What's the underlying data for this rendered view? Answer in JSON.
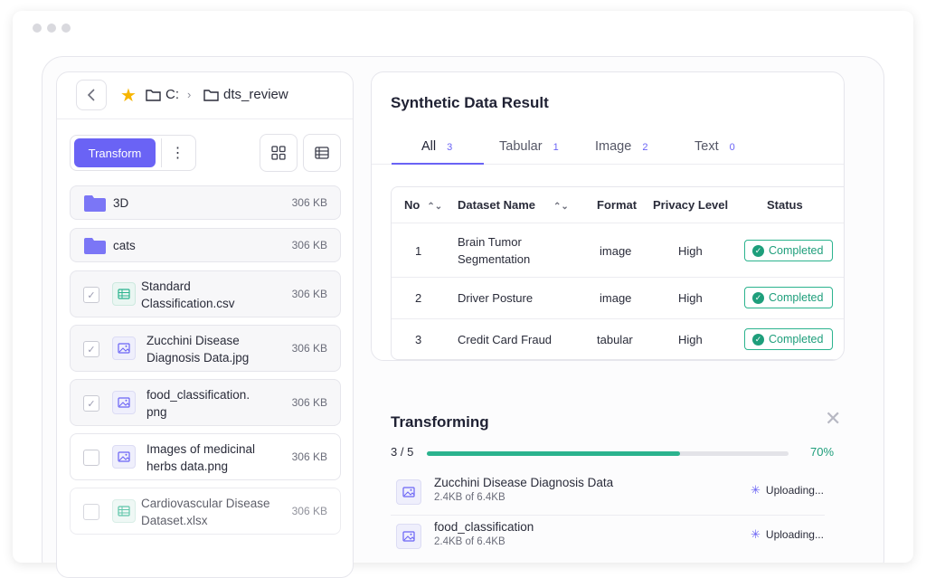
{
  "breadcrumb": {
    "drive": "C:",
    "folder": "dts_review"
  },
  "toolbar": {
    "transform_label": "Transform",
    "more_label": "⋮"
  },
  "files": [
    {
      "name": "3D",
      "size": "306 KB",
      "type": "folder"
    },
    {
      "name": "cats",
      "size": "306 KB",
      "type": "folder"
    },
    {
      "name": "Standard Classification.csv",
      "size": "306 KB",
      "type": "sheet",
      "checked": true
    },
    {
      "name": "Zucchini Disease Diagnosis Data.jpg",
      "size": "306 KB",
      "type": "image",
      "checked": true
    },
    {
      "name": "food_classification. png",
      "size": "306 KB",
      "type": "image",
      "checked": true
    },
    {
      "name": "Images of medicinal herbs data.png",
      "size": "306 KB",
      "type": "image",
      "checked": false
    },
    {
      "name": "Cardiovascular Disease Dataset.xlsx",
      "size": "306 KB",
      "type": "sheet",
      "checked": false
    }
  ],
  "result": {
    "title": "Synthetic Data Result",
    "tabs": [
      {
        "label": "All",
        "count": "3"
      },
      {
        "label": "Tabular",
        "count": "1"
      },
      {
        "label": "Image",
        "count": "2"
      },
      {
        "label": "Text",
        "count": "0"
      }
    ],
    "columns": {
      "no": "No",
      "name": "Dataset Name",
      "format": "Format",
      "privacy": "Privacy Level",
      "status": "Status"
    },
    "rows": [
      {
        "no": "1",
        "name": "Brain Tumor Segmentation",
        "format": "image",
        "privacy": "High",
        "status": "Completed"
      },
      {
        "no": "2",
        "name": "Driver Posture",
        "format": "image",
        "privacy": "High",
        "status": "Completed"
      },
      {
        "no": "3",
        "name": "Credit Card Fraud",
        "format": "tabular",
        "privacy": "High",
        "status": "Completed"
      }
    ]
  },
  "transforming": {
    "title": "Transforming",
    "progress_label": "3 / 5",
    "percent_label": "70%",
    "percent": 70,
    "items": [
      {
        "name": "Zucchini Disease Diagnosis Data",
        "size": "2.4KB of 6.4KB",
        "status": "Uploading..."
      },
      {
        "name": "food_classification",
        "size": "2.4KB of 6.4KB",
        "status": "Uploading..."
      }
    ]
  },
  "colors": {
    "accent": "#6a63f5",
    "success": "#2bb38e"
  }
}
